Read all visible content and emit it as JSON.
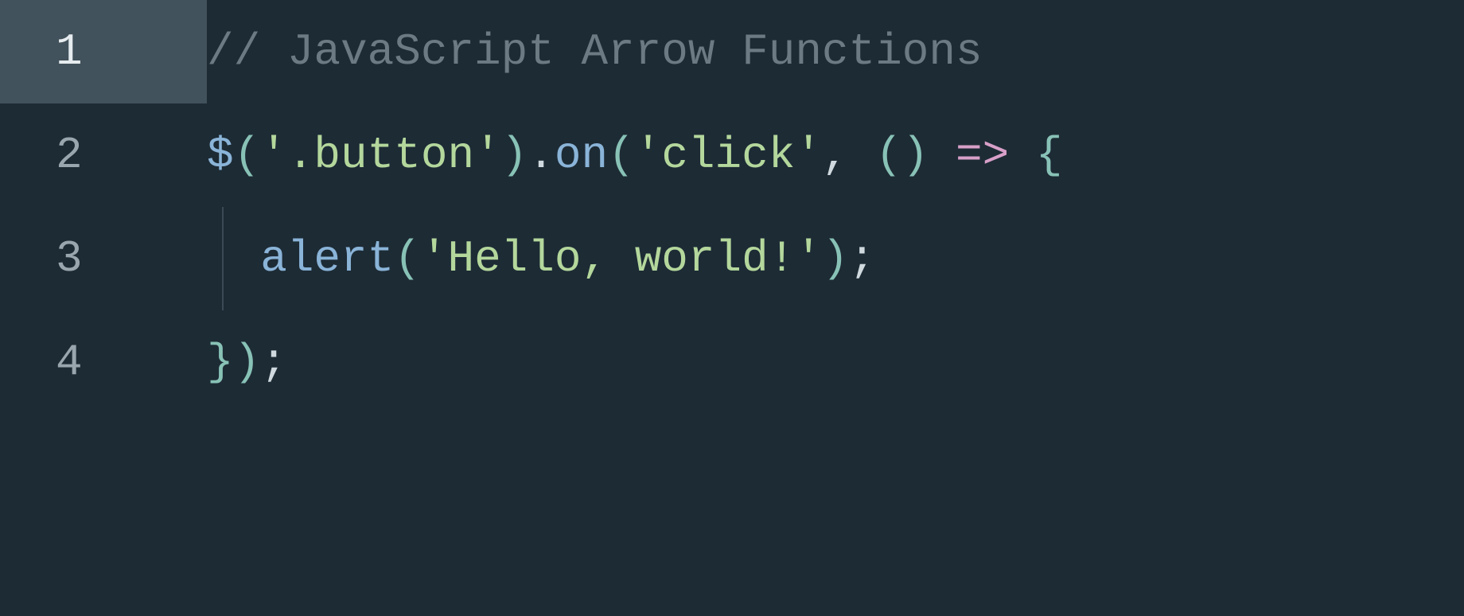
{
  "editor": {
    "active_line": 1,
    "lines": {
      "1": {
        "number": "1"
      },
      "2": {
        "number": "2"
      },
      "3": {
        "number": "3"
      },
      "4": {
        "number": "4"
      }
    },
    "tokens": {
      "l1_comment": "// JavaScript Arrow Functions",
      "l2_dollar": "$",
      "l2_paren_open1": "(",
      "l2_str1": "'.button'",
      "l2_paren_close1": ")",
      "l2_dot": ".",
      "l2_on": "on",
      "l2_paren_open2": "(",
      "l2_str2": "'click'",
      "l2_comma": ", ",
      "l2_paren_open3": "(",
      "l2_paren_close3": ")",
      "l2_space": " ",
      "l2_arrow": "=>",
      "l2_space2": " ",
      "l2_brace_open": "{",
      "l3_indent": "  ",
      "l3_alert": "alert",
      "l3_paren_open": "(",
      "l3_str": "'Hello, world!'",
      "l3_paren_close": ")",
      "l3_semi": ";",
      "l4_brace_close": "}",
      "l4_paren_close": ")",
      "l4_semi": ";"
    }
  }
}
